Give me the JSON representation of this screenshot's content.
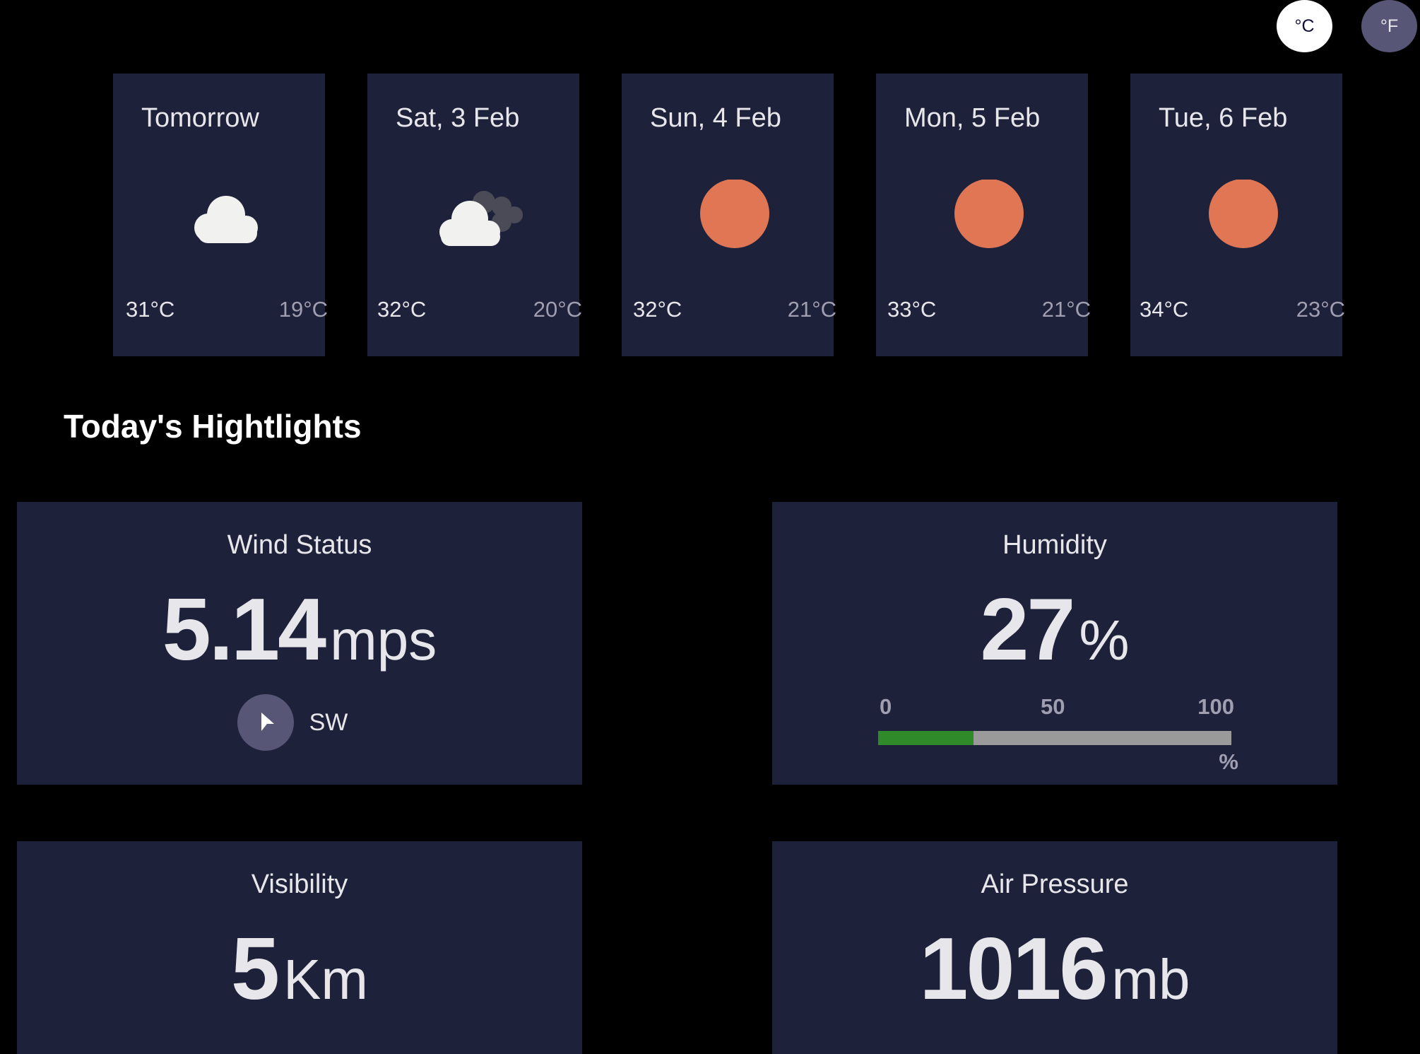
{
  "units": {
    "celsius_label": "°C",
    "fahrenheit_label": "°F"
  },
  "forecast": [
    {
      "date": "Tomorrow",
      "icon": "cloud-icon",
      "max": "31°C",
      "min": "19°C"
    },
    {
      "date": "Sat, 3 Feb",
      "icon": "heavy-cloud-icon",
      "max": "32°C",
      "min": "20°C"
    },
    {
      "date": "Sun, 4 Feb",
      "icon": "sun-icon",
      "max": "32°C",
      "min": "21°C"
    },
    {
      "date": "Mon, 5 Feb",
      "icon": "sun-icon",
      "max": "33°C",
      "min": "21°C"
    },
    {
      "date": "Tue, 6 Feb",
      "icon": "sun-icon",
      "max": "34°C",
      "min": "23°C"
    }
  ],
  "highlights": {
    "title": "Today's Hightlights",
    "wind": {
      "title": "Wind Status",
      "value": "5.14",
      "unit": "mps",
      "direction": "SW",
      "icon": "navigation-arrow-icon"
    },
    "humidity": {
      "title": "Humidity",
      "value": "27",
      "unit": "%",
      "scale_min": "0",
      "scale_mid": "50",
      "scale_max": "100",
      "scale_unit": "%",
      "level_percent": 27
    },
    "visibility": {
      "title": "Visibility",
      "value": "5",
      "unit": "Km"
    },
    "pressure": {
      "title": "Air Pressure",
      "value": "1016",
      "unit": "mb"
    }
  },
  "colors": {
    "background": "#000000",
    "card": "#1E213A",
    "sun": "#E07654",
    "humidity_fill": "#2F8A2A",
    "humidity_track": "#9A9A9A",
    "button_active": "#FFFFFF",
    "button_inactive": "#585676"
  }
}
